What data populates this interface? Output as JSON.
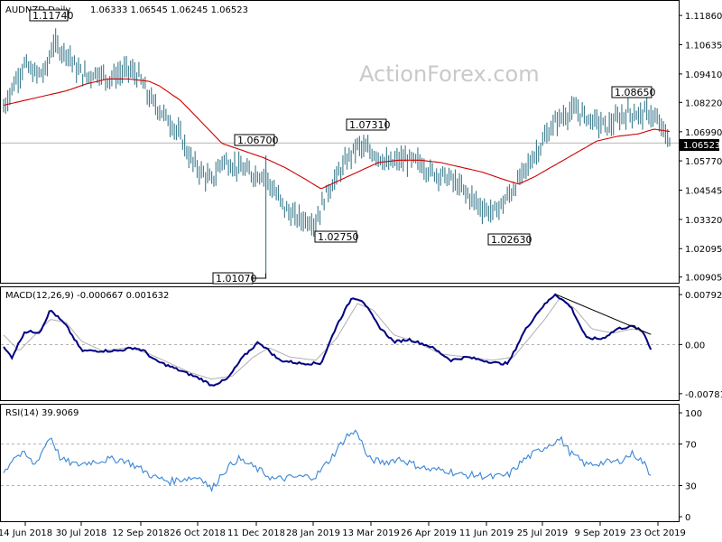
{
  "header": {
    "symbol": "AUDNZD,Daily",
    "ohlc": "1.06333 1.06545 1.06245 1.06523"
  },
  "watermark": "ActionForex.com",
  "last_price_label": "1.06523",
  "chart_data": [
    {
      "type": "bar",
      "panel": "price",
      "title": "AUDNZD,Daily  1.06333 1.06545 1.06245 1.06523",
      "ylim": [
        1.0078,
        1.1228
      ],
      "y_ticks": [
        "1.11860",
        "1.10635",
        "1.09410",
        "1.08220",
        "1.06990",
        "1.05770",
        "1.04545",
        "1.03320",
        "1.02095",
        "1.00905"
      ],
      "y_tick_values": [
        1.1186,
        1.10635,
        1.0941,
        1.0822,
        1.0699,
        1.0577,
        1.04545,
        1.0332,
        1.02095,
        1.00905
      ],
      "x_ticks": [
        "14 Jun 2018",
        "30 Jul 2018",
        "12 Sep 2018",
        "26 Oct 2018",
        "11 Dec 2018",
        "28 Jan 2019",
        "13 Mar 2019",
        "26 Apr 2019",
        "11 Jun 2019",
        "25 Jul 2019",
        "9 Sep 2019",
        "23 Oct 2019"
      ],
      "series": [
        {
          "name": "AUDNZD",
          "close_anchors": [
            [
              0,
              1.08
            ],
            [
              10,
              1.09
            ],
            [
              20,
              1.098
            ],
            [
              30,
              1.094
            ],
            [
              40,
              1.095
            ],
            [
              48,
              1.107
            ],
            [
              55,
              1.104
            ],
            [
              62,
              1.103
            ],
            [
              70,
              1.096
            ],
            [
              80,
              1.093
            ],
            [
              90,
              1.095
            ],
            [
              100,
              1.092
            ],
            [
              110,
              1.094
            ],
            [
              120,
              1.096
            ],
            [
              130,
              1.093
            ],
            [
              140,
              1.084
            ],
            [
              150,
              1.079
            ],
            [
              160,
              1.074
            ],
            [
              170,
              1.068
            ],
            [
              180,
              1.058
            ],
            [
              190,
              1.053
            ],
            [
              200,
              1.049
            ],
            [
              210,
              1.058
            ],
            [
              220,
              1.056
            ],
            [
              230,
              1.054
            ],
            [
              240,
              1.052
            ],
            [
              250,
              1.052
            ],
            [
              260,
              1.045
            ],
            [
              270,
              1.038
            ],
            [
              280,
              1.034
            ],
            [
              290,
              1.033
            ],
            [
              300,
              1.032
            ],
            [
              310,
              1.044
            ],
            [
              320,
              1.051
            ],
            [
              330,
              1.058
            ],
            [
              340,
              1.064
            ],
            [
              350,
              1.062
            ],
            [
              360,
              1.06
            ],
            [
              370,
              1.056
            ],
            [
              380,
              1.058
            ],
            [
              390,
              1.058
            ],
            [
              400,
              1.057
            ],
            [
              410,
              1.053
            ],
            [
              420,
              1.052
            ],
            [
              430,
              1.05
            ],
            [
              440,
              1.046
            ],
            [
              450,
              1.042
            ],
            [
              460,
              1.038
            ],
            [
              470,
              1.036
            ],
            [
              480,
              1.04
            ],
            [
              490,
              1.046
            ],
            [
              500,
              1.053
            ],
            [
              510,
              1.06
            ],
            [
              520,
              1.067
            ],
            [
              530,
              1.074
            ],
            [
              540,
              1.077
            ],
            [
              550,
              1.079
            ],
            [
              560,
              1.076
            ],
            [
              570,
              1.074
            ],
            [
              580,
              1.072
            ],
            [
              590,
              1.075
            ],
            [
              600,
              1.078
            ],
            [
              610,
              1.077
            ],
            [
              620,
              1.078
            ],
            [
              630,
              1.073
            ],
            [
              640,
              1.066
            ]
          ]
        },
        {
          "name": "MA",
          "anchors": [
            [
              0,
              1.081
            ],
            [
              20,
              1.083
            ],
            [
              40,
              1.085
            ],
            [
              60,
              1.087
            ],
            [
              80,
              1.09
            ],
            [
              100,
              1.092
            ],
            [
              120,
              1.092
            ],
            [
              140,
              1.091
            ],
            [
              150,
              1.089
            ],
            [
              170,
              1.083
            ],
            [
              190,
              1.074
            ],
            [
              210,
              1.065
            ],
            [
              230,
              1.062
            ],
            [
              250,
              1.059
            ],
            [
              270,
              1.055
            ],
            [
              290,
              1.05
            ],
            [
              305,
              1.046
            ],
            [
              320,
              1.049
            ],
            [
              340,
              1.053
            ],
            [
              360,
              1.057
            ],
            [
              380,
              1.058
            ],
            [
              400,
              1.058
            ],
            [
              420,
              1.057
            ],
            [
              440,
              1.055
            ],
            [
              460,
              1.053
            ],
            [
              480,
              1.05
            ],
            [
              495,
              1.048
            ],
            [
              510,
              1.051
            ],
            [
              530,
              1.056
            ],
            [
              550,
              1.061
            ],
            [
              570,
              1.066
            ],
            [
              590,
              1.068
            ],
            [
              610,
              1.069
            ],
            [
              625,
              1.071
            ],
            [
              640,
              1.07
            ]
          ]
        }
      ],
      "annotations": [
        {
          "text": "1.11740",
          "value": 1.1174
        },
        {
          "text": "1.06700",
          "value": 1.067
        },
        {
          "text": "1.01070",
          "value": 1.0107
        },
        {
          "text": "1.07310",
          "value": 1.0731
        },
        {
          "text": "1.02750",
          "value": 1.0275
        },
        {
          "text": "1.02630",
          "value": 1.0263
        },
        {
          "text": "1.08650",
          "value": 1.0865
        }
      ],
      "reference_line": 1.06523,
      "colors": {
        "bars": "#3a7a8c",
        "ma": "#cc0000"
      }
    },
    {
      "type": "line",
      "panel": "macd",
      "title": "MACD(12,26,9) -0.000667 0.001632",
      "ylim": [
        -0.0087,
        0.0088
      ],
      "y_ticks": [
        "0.007923",
        "0.00",
        "-0.007816"
      ],
      "y_tick_values": [
        0.007923,
        0.0,
        -0.007816
      ],
      "series": [
        {
          "name": "MACD",
          "anchors": [
            [
              0,
              -0.0005
            ],
            [
              8,
              -0.002
            ],
            [
              20,
              0.002
            ],
            [
              35,
              0.002
            ],
            [
              45,
              0.0055
            ],
            [
              60,
              0.003
            ],
            [
              75,
              -0.001
            ],
            [
              90,
              -0.001
            ],
            [
              110,
              -0.001
            ],
            [
              125,
              -0.0005
            ],
            [
              135,
              -0.001
            ],
            [
              145,
              -0.0025
            ],
            [
              160,
              -0.0035
            ],
            [
              175,
              -0.0045
            ],
            [
              190,
              -0.0055
            ],
            [
              200,
              -0.0065
            ],
            [
              215,
              -0.0055
            ],
            [
              230,
              -0.002
            ],
            [
              245,
              0.0004
            ],
            [
              255,
              -0.001
            ],
            [
              265,
              -0.0025
            ],
            [
              285,
              -0.003
            ],
            [
              305,
              -0.003
            ],
            [
              320,
              0.003
            ],
            [
              335,
              0.0075
            ],
            [
              345,
              0.007
            ],
            [
              360,
              0.003
            ],
            [
              375,
              0.0004
            ],
            [
              390,
              0.0008
            ],
            [
              410,
              -0.0003
            ],
            [
              430,
              -0.0025
            ],
            [
              445,
              -0.002
            ],
            [
              460,
              -0.0025
            ],
            [
              475,
              -0.003
            ],
            [
              485,
              -0.003
            ],
            [
              500,
              0.002
            ],
            [
              515,
              0.0055
            ],
            [
              530,
              0.008
            ],
            [
              545,
              0.006
            ],
            [
              560,
              0.001
            ],
            [
              575,
              0.0009
            ],
            [
              590,
              0.0025
            ],
            [
              605,
              0.0029
            ],
            [
              615,
              0.0019
            ],
            [
              622,
              -0.0007
            ]
          ]
        },
        {
          "name": "Signal",
          "anchors": [
            [
              0,
              0.0015
            ],
            [
              15,
              -0.001
            ],
            [
              30,
              0.0015
            ],
            [
              45,
              0.004
            ],
            [
              60,
              0.0035
            ],
            [
              75,
              0.0005
            ],
            [
              95,
              -0.001
            ],
            [
              120,
              -0.0005
            ],
            [
              140,
              -0.0015
            ],
            [
              160,
              -0.003
            ],
            [
              180,
              -0.0045
            ],
            [
              200,
              -0.0055
            ],
            [
              220,
              -0.005
            ],
            [
              240,
              -0.002
            ],
            [
              255,
              -0.0005
            ],
            [
              275,
              -0.002
            ],
            [
              300,
              -0.0025
            ],
            [
              320,
              0.001
            ],
            [
              340,
              0.0065
            ],
            [
              355,
              0.0055
            ],
            [
              375,
              0.0015
            ],
            [
              395,
              0.0005
            ],
            [
              420,
              -0.0015
            ],
            [
              445,
              -0.002
            ],
            [
              470,
              -0.0025
            ],
            [
              490,
              -0.002
            ],
            [
              505,
              0.001
            ],
            [
              520,
              0.004
            ],
            [
              535,
              0.0075
            ],
            [
              550,
              0.0055
            ],
            [
              565,
              0.0025
            ],
            [
              585,
              0.0018
            ],
            [
              605,
              0.0025
            ],
            [
              622,
              0.0016
            ]
          ]
        },
        {
          "name": "Trendline",
          "anchors": [
            [
              530,
              0.008
            ],
            [
              622,
              0.0016
            ]
          ]
        }
      ],
      "colors": {
        "macd": "#000080",
        "signal": "#b0b0b0",
        "trendline": "#000000"
      }
    },
    {
      "type": "line",
      "panel": "rsi",
      "title": "RSI(14) 39.9069",
      "ylim": [
        0,
        100
      ],
      "y_ticks": [
        "100",
        "70",
        "30",
        "0"
      ],
      "y_tick_values": [
        100,
        70,
        30,
        0
      ],
      "levels": [
        70,
        30
      ],
      "series": [
        {
          "name": "RSI",
          "anchors": [
            [
              0,
              42
            ],
            [
              10,
              58
            ],
            [
              20,
              60
            ],
            [
              30,
              50
            ],
            [
              45,
              78
            ],
            [
              55,
              55
            ],
            [
              70,
              50
            ],
            [
              85,
              53
            ],
            [
              100,
              55
            ],
            [
              115,
              55
            ],
            [
              130,
              47
            ],
            [
              145,
              38
            ],
            [
              160,
              34
            ],
            [
              175,
              37
            ],
            [
              190,
              38
            ],
            [
              200,
              26
            ],
            [
              210,
              42
            ],
            [
              225,
              56
            ],
            [
              240,
              48
            ],
            [
              260,
              36
            ],
            [
              280,
              38
            ],
            [
              300,
              39
            ],
            [
              315,
              57
            ],
            [
              330,
              78
            ],
            [
              340,
              82
            ],
            [
              350,
              56
            ],
            [
              365,
              52
            ],
            [
              380,
              56
            ],
            [
              395,
              50
            ],
            [
              410,
              45
            ],
            [
              425,
              45
            ],
            [
              440,
              40
            ],
            [
              455,
              40
            ],
            [
              470,
              38
            ],
            [
              485,
              40
            ],
            [
              500,
              55
            ],
            [
              515,
              64
            ],
            [
              525,
              70
            ],
            [
              535,
              75
            ],
            [
              545,
              61
            ],
            [
              560,
              50
            ],
            [
              575,
              52
            ],
            [
              590,
              53
            ],
            [
              605,
              61
            ],
            [
              615,
              52
            ],
            [
              622,
              40
            ]
          ]
        }
      ],
      "colors": {
        "rsi": "#3a86d6",
        "levels": "#999999"
      }
    }
  ]
}
